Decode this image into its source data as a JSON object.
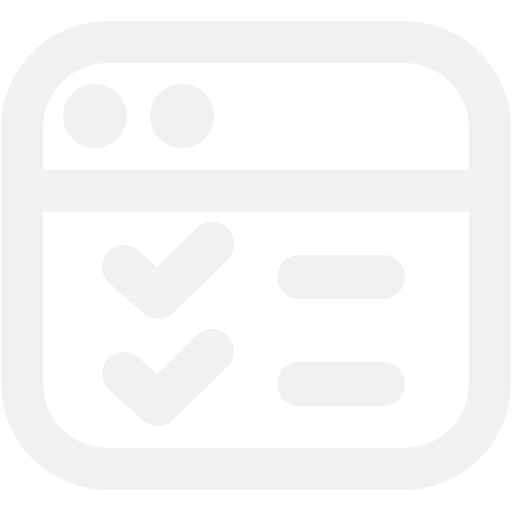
{
  "icon": {
    "name": "browser-checklist-icon",
    "stroke_color": "#f0f1f1"
  },
  "window_controls": [
    {
      "name": "window-dot-1"
    },
    {
      "name": "window-dot-2"
    }
  ],
  "checklist": [
    {
      "name": "checklist-item-1",
      "checked": true
    },
    {
      "name": "checklist-item-2",
      "checked": true
    }
  ]
}
